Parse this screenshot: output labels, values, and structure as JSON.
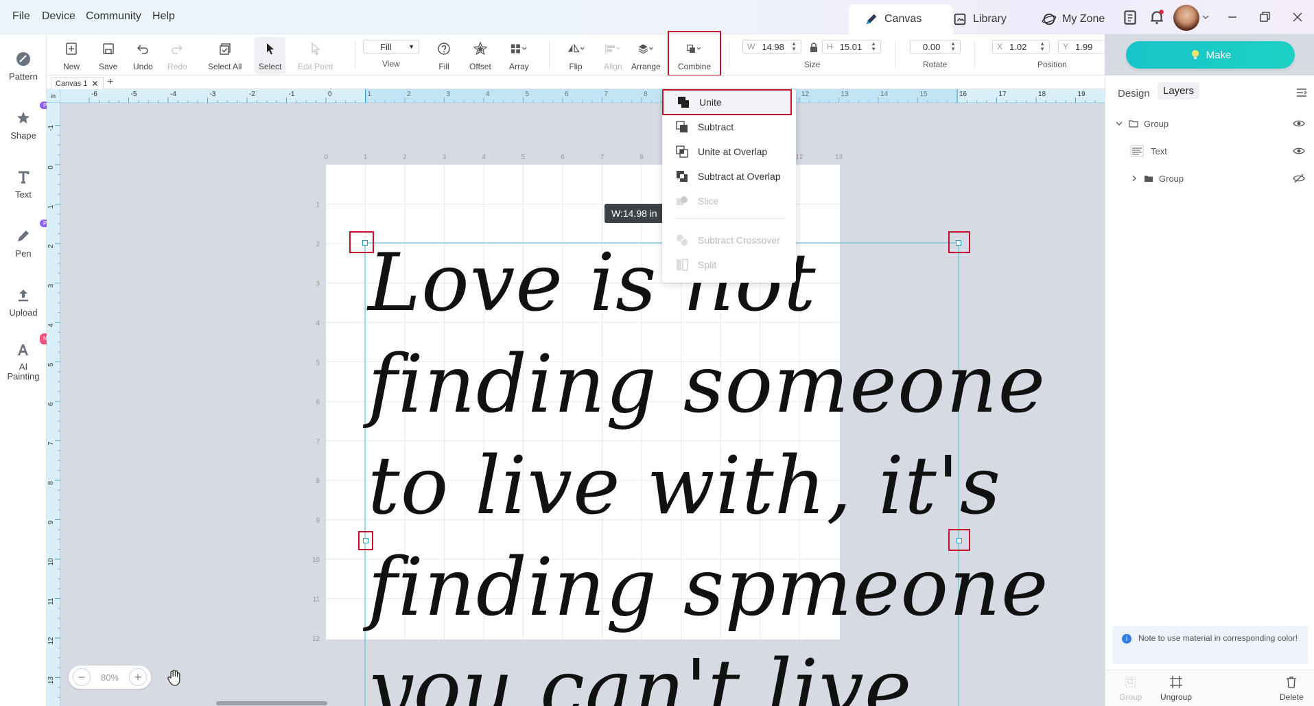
{
  "menu": {
    "file": "File",
    "device": "Device",
    "community": "Community",
    "help": "Help"
  },
  "topnav": {
    "canvas": "Canvas",
    "library": "Library",
    "myzone": "My Zone"
  },
  "toolbar": {
    "new": "New",
    "save": "Save",
    "undo": "Undo",
    "redo": "Redo",
    "select_all": "Select All",
    "select": "Select",
    "edit_point": "Edit Point",
    "view_value": "Fill",
    "view_label": "View",
    "fill": "Fill",
    "offset": "Offset",
    "array": "Array",
    "flip": "Flip",
    "align": "Align",
    "arrange": "Arrange",
    "combine": "Combine",
    "size_label": "Size",
    "w_prefix": "W",
    "w_value": "14.98",
    "h_prefix": "H",
    "h_value": "15.01",
    "rotate_label": "Rotate",
    "rotate_value": "0.00",
    "position_label": "Position",
    "x_prefix": "X",
    "x_value": "1.02",
    "y_prefix": "Y",
    "y_value": "1.99"
  },
  "make_button": "Make",
  "sidebar": [
    {
      "label": "Pattern",
      "badge": ""
    },
    {
      "label": "Shape",
      "badge": "Pro"
    },
    {
      "label": "Text",
      "badge": ""
    },
    {
      "label": "Pen",
      "badge": "Pro"
    },
    {
      "label": "Upload",
      "badge": ""
    },
    {
      "label": "AI Painting",
      "badge": "New"
    }
  ],
  "canvas_tab": "Canvas 1",
  "ruler": {
    "unit": "in",
    "h_ticks": [
      "-6",
      "-5",
      "-4",
      "-3",
      "-2",
      "-1",
      "0",
      "1",
      "2",
      "3",
      "4",
      "5",
      "6",
      "7",
      "8",
      "9",
      "10",
      "11",
      "12",
      "13",
      "14",
      "15",
      "16",
      "17",
      "18",
      "19"
    ],
    "v_ticks": [
      "-1",
      "0",
      "1",
      "2",
      "3",
      "4",
      "5",
      "6",
      "7",
      "8",
      "9",
      "10",
      "11",
      "12",
      "13"
    ],
    "mat_h_ticks": [
      "0",
      "1",
      "2",
      "3",
      "4",
      "5",
      "6",
      "7",
      "8",
      "9",
      "10",
      "11",
      "12",
      "13"
    ],
    "mat_v_ticks": [
      "1",
      "2",
      "3",
      "4",
      "5",
      "6",
      "7",
      "8",
      "9",
      "10",
      "11",
      "12"
    ]
  },
  "canvas": {
    "text_lines": [
      "Love is not",
      "finding someone",
      "to live with, it's",
      "finding spmeone",
      "you can't live"
    ],
    "dimension_tooltip": "W:14.98 in"
  },
  "combine_menu": {
    "unite": "Unite",
    "subtract": "Subtract",
    "unite_overlap": "Unite at Overlap",
    "subtract_overlap": "Subtract at Overlap",
    "slice": "Slice",
    "subtract_crossover": "Subtract Crossover",
    "split": "Split"
  },
  "zoom": {
    "value": "80%"
  },
  "right_panel": {
    "tab_design": "Design",
    "tab_layers": "Layers",
    "layers": [
      "Group",
      "Text",
      "Group"
    ],
    "note": "Note to use material in corresponding color!",
    "btn_group": "Group",
    "btn_ungroup": "Ungroup",
    "btn_delete": "Delete"
  }
}
